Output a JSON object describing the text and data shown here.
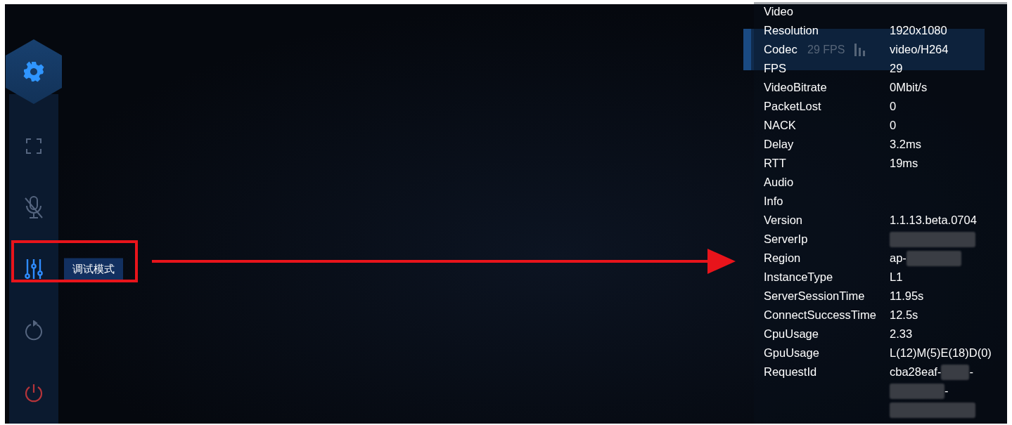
{
  "sidebar": {
    "items": [
      {
        "kind": "fullscreen",
        "selected": false
      },
      {
        "kind": "mic-off",
        "selected": false
      },
      {
        "kind": "tuning",
        "selected": true,
        "tooltip": "调试模式"
      },
      {
        "kind": "refresh",
        "selected": false
      },
      {
        "kind": "power",
        "selected": false
      }
    ]
  },
  "status_bar": {
    "fps": "29 FPS"
  },
  "stats": [
    {
      "kind": "header",
      "label": "Video"
    },
    {
      "kind": "row",
      "label": "Resolution",
      "lines": [
        [
          {
            "kind": "text",
            "text": "1920x1080"
          }
        ]
      ]
    },
    {
      "kind": "row",
      "label": "Codec",
      "lines": [
        [
          {
            "kind": "text",
            "text": "video/H264"
          }
        ]
      ]
    },
    {
      "kind": "row",
      "label": "FPS",
      "lines": [
        [
          {
            "kind": "text",
            "text": "29"
          }
        ]
      ]
    },
    {
      "kind": "row",
      "label": "VideoBitrate",
      "lines": [
        [
          {
            "kind": "text",
            "text": "0Mbit/s"
          }
        ]
      ]
    },
    {
      "kind": "row",
      "label": "PacketLost",
      "lines": [
        [
          {
            "kind": "text",
            "text": "0"
          }
        ]
      ]
    },
    {
      "kind": "row",
      "label": "NACK",
      "lines": [
        [
          {
            "kind": "text",
            "text": "0"
          }
        ]
      ]
    },
    {
      "kind": "row",
      "label": "Delay",
      "lines": [
        [
          {
            "kind": "text",
            "text": "3.2ms"
          }
        ]
      ]
    },
    {
      "kind": "row",
      "label": "RTT",
      "lines": [
        [
          {
            "kind": "text",
            "text": "19ms"
          }
        ]
      ]
    },
    {
      "kind": "header",
      "label": "Audio"
    },
    {
      "kind": "header",
      "label": "Info"
    },
    {
      "kind": "row",
      "label": "Version",
      "lines": [
        [
          {
            "kind": "text",
            "text": "1.1.13.beta.0704"
          }
        ]
      ]
    },
    {
      "kind": "row",
      "label": "ServerIp",
      "lines": [
        [
          {
            "kind": "redacted"
          }
        ]
      ]
    },
    {
      "kind": "row",
      "label": "Region",
      "lines": [
        [
          {
            "kind": "text",
            "text": "ap-"
          },
          {
            "kind": "redacted"
          }
        ]
      ]
    },
    {
      "kind": "row",
      "label": "InstanceType",
      "lines": [
        [
          {
            "kind": "text",
            "text": "L1"
          }
        ]
      ]
    },
    {
      "kind": "row",
      "label": "ServerSessionTime",
      "lines": [
        [
          {
            "kind": "text",
            "text": "11.95s"
          }
        ]
      ]
    },
    {
      "kind": "row",
      "label": "ConnectSuccessTime",
      "lines": [
        [
          {
            "kind": "text",
            "text": "12.5s"
          }
        ]
      ]
    },
    {
      "kind": "row",
      "label": "CpuUsage",
      "lines": [
        [
          {
            "kind": "text",
            "text": "2.33"
          }
        ]
      ]
    },
    {
      "kind": "row",
      "label": "GpuUsage",
      "lines": [
        [
          {
            "kind": "text",
            "text": "L(12)M(5)E(18)D(0)"
          }
        ]
      ]
    },
    {
      "kind": "row",
      "label": "RequestId",
      "lines": [
        [
          {
            "kind": "text",
            "text": "cba28eaf-"
          },
          {
            "kind": "redacted"
          },
          {
            "kind": "text",
            "text": "-"
          }
        ],
        [
          {
            "kind": "redacted"
          },
          {
            "kind": "text",
            "text": "-"
          }
        ],
        [
          {
            "kind": "redacted"
          }
        ]
      ]
    }
  ]
}
